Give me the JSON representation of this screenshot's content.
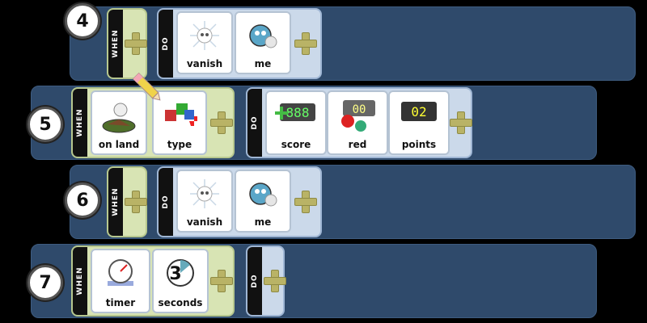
{
  "rules": [
    {
      "number": "4",
      "when_label": "WHEN",
      "do_label": "DO",
      "when_tiles": [],
      "do_tiles": [
        {
          "label": "vanish",
          "icon": "sparkle-burst-icon"
        },
        {
          "label": "me",
          "icon": "kodu-bot-icon"
        }
      ]
    },
    {
      "number": "5",
      "when_label": "WHEN",
      "do_label": "DO",
      "when_tiles": [
        {
          "label": "on land",
          "icon": "land-terrain-icon"
        },
        {
          "label": "type",
          "icon": "type-blocks-icon"
        }
      ],
      "do_tiles": [
        {
          "label": "score",
          "icon": "score-display-icon",
          "display": "888"
        },
        {
          "label": "red",
          "icon": "red-score-icon",
          "display": "00"
        },
        {
          "label": "points",
          "icon": "points-display-icon",
          "display": "02"
        }
      ]
    },
    {
      "number": "6",
      "when_label": "WHEN",
      "do_label": "DO",
      "when_tiles": [],
      "do_tiles": [
        {
          "label": "vanish",
          "icon": "sparkle-burst-icon"
        },
        {
          "label": "me",
          "icon": "kodu-bot-icon"
        }
      ]
    },
    {
      "number": "7",
      "when_label": "WHEN",
      "do_label": "DO",
      "when_tiles": [
        {
          "label": "timer",
          "icon": "stopwatch-icon"
        },
        {
          "label": "seconds",
          "icon": "seconds-3-icon",
          "display": "3"
        }
      ],
      "do_tiles": []
    }
  ],
  "colors": {
    "row_bg": "#2f4a6b",
    "when_bg": "#d8e4b4",
    "do_bg": "#cbd9ea",
    "plus": "#b9b366"
  }
}
